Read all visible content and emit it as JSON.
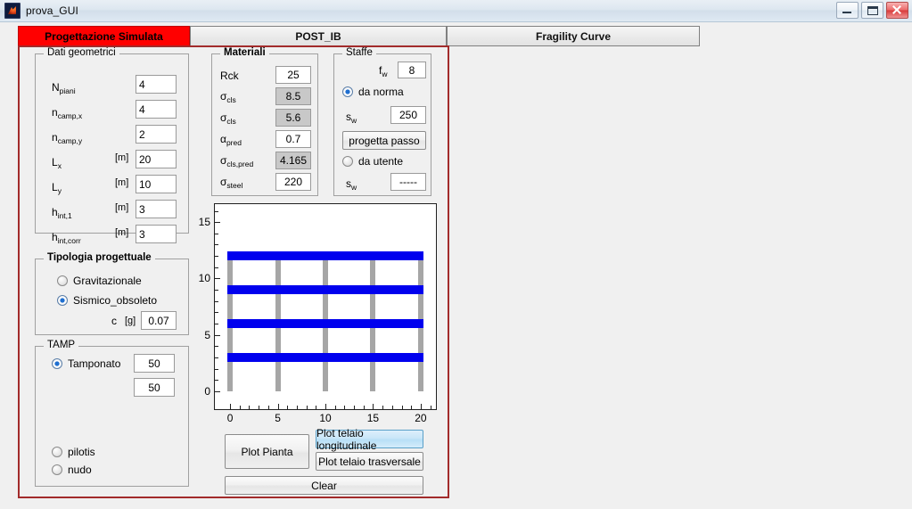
{
  "window": {
    "title": "prova_GUI",
    "icon": "matlab-icon",
    "controls": {
      "minimize": "minimize-icon",
      "maximize": "maximize-icon",
      "close": "close-icon"
    }
  },
  "tabs": [
    {
      "label": "Progettazione Simulata",
      "active": true
    },
    {
      "label": "POST_IB",
      "active": false
    },
    {
      "label": "Fragility Curve",
      "active": false
    }
  ],
  "panels": {
    "geometry": {
      "title": "Dati geometrici",
      "fields": [
        {
          "name": "N",
          "sub": "piani",
          "unit": "",
          "value": "4"
        },
        {
          "name": "n",
          "sub": "camp,x",
          "unit": "",
          "value": "4"
        },
        {
          "name": "n",
          "sub": "camp,y",
          "unit": "",
          "value": "2"
        },
        {
          "name": "L",
          "sub": "x",
          "unit": "[m]",
          "value": "20"
        },
        {
          "name": "L",
          "sub": "y",
          "unit": "[m]",
          "value": "10"
        },
        {
          "name": "h",
          "sub": "int,1",
          "unit": "[m]",
          "value": "3"
        },
        {
          "name": "h",
          "sub": "int,corr",
          "unit": "[m]",
          "value": "3"
        }
      ]
    },
    "typology": {
      "title": "Tipologia progettuale",
      "options": [
        {
          "label": "Gravitazionale",
          "selected": false
        },
        {
          "label": "Sismico_obsoleto",
          "selected": true
        }
      ],
      "c_label": "c",
      "c_unit": "[g]",
      "c_value": "0.07"
    },
    "tamp": {
      "title": "TAMP",
      "options": [
        {
          "label": "Tamponato",
          "selected": true
        },
        {
          "label": "pilotis",
          "selected": false
        },
        {
          "label": "nudo",
          "selected": false
        }
      ],
      "value1": "50",
      "value2": "50"
    },
    "materials": {
      "title": "Materiali",
      "fields": [
        {
          "name": "Rck",
          "sub": "",
          "value": "25",
          "readonly": false
        },
        {
          "name": "σ",
          "sub": "cls",
          "value": "8.5",
          "readonly": true
        },
        {
          "name": "σ",
          "sub": "cls",
          "value": "5.6",
          "readonly": true
        },
        {
          "name": "α",
          "sub": "pred",
          "value": "0.7",
          "readonly": false
        },
        {
          "name": "σ",
          "sub": "cls,pred",
          "value": "4.165",
          "readonly": true
        },
        {
          "name": "σ",
          "sub": "steel",
          "value": "220",
          "readonly": false
        }
      ]
    },
    "stirrups": {
      "title": "Staffe",
      "fw_label": "f",
      "fw_sub": "w",
      "fw_value": "8",
      "mode_norm": {
        "label": "da norma",
        "selected": true
      },
      "sw_norm_label": "s",
      "sw_norm_sub": "w",
      "sw_norm_value": "250",
      "design_button": "progetta passo",
      "mode_user": {
        "label": "da utente",
        "selected": false
      },
      "sw_user_label": "s",
      "sw_user_sub": "w",
      "sw_user_value": "-----"
    }
  },
  "buttons": {
    "plot_plan": "Plot Pianta",
    "plot_long": "Plot telaio longitudinale",
    "plot_trans": "Plot telaio trasversale",
    "clear": "Clear"
  },
  "chart_data": {
    "type": "line",
    "title": "",
    "xlabel": "",
    "ylabel": "",
    "xlim": [
      -1.6,
      21.6
    ],
    "ylim": [
      -1.6,
      16.6
    ],
    "xticks": [
      0,
      5,
      10,
      15,
      20
    ],
    "yticks": [
      0,
      5,
      10,
      15
    ],
    "xtick_labels": [
      "0",
      "5",
      "10",
      "15",
      "20"
    ],
    "ytick_labels": [
      "0",
      "5",
      "10",
      "15"
    ],
    "grid": false,
    "legend": false,
    "series": [
      {
        "name": "columns",
        "color": "#a6a6a6",
        "x": [
          0,
          5,
          10,
          15,
          20
        ],
        "y_bottom": 0,
        "y_top": 12
      },
      {
        "name": "beams",
        "color": "#0000ee",
        "y": [
          3,
          6,
          9,
          12
        ],
        "x_left": 0,
        "x_right": 20
      }
    ]
  }
}
